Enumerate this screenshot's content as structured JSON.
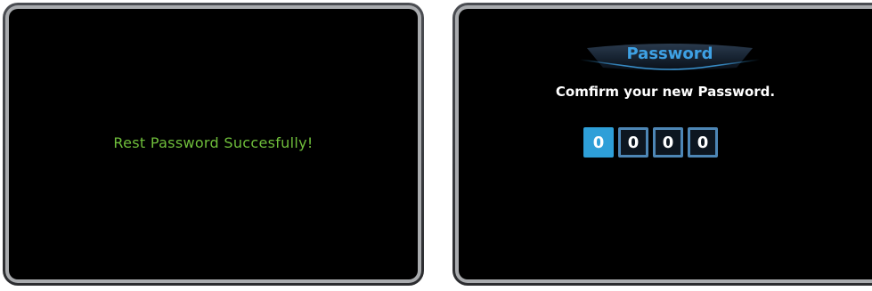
{
  "left_screen": {
    "message": "Rest Password Succesfully!"
  },
  "right_screen": {
    "title": "Password",
    "prompt": "Comfirm your new Password.",
    "digits": [
      "0",
      "0",
      "0",
      "0"
    ],
    "active_digit_index": 0
  },
  "colors": {
    "success_text": "#6fbe3b",
    "title_text": "#3ea1e4",
    "digit_active": "#2e9fd8",
    "digit_border": "#4d86b5",
    "screen_bg": "#000000"
  }
}
